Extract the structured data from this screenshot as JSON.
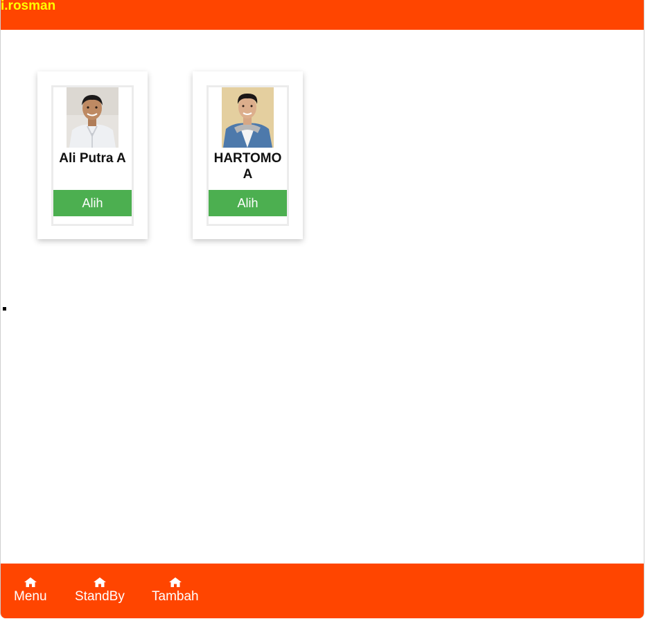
{
  "header": {
    "username": "i.rosman"
  },
  "cards": [
    {
      "name": "Ali Putra A",
      "button_label": "Alih",
      "photo_icon": "person-photo-icon"
    },
    {
      "name": "HARTOMO A",
      "button_label": "Alih",
      "photo_icon": "person-photo-icon"
    }
  ],
  "footer": {
    "items": [
      {
        "label": "Menu",
        "icon": "home-icon"
      },
      {
        "label": "StandBy",
        "icon": "home-icon"
      },
      {
        "label": "Tambah",
        "icon": "home-icon"
      }
    ]
  },
  "colors": {
    "brand": "#ff4500",
    "username": "#ffff00",
    "button": "#4caf50"
  }
}
